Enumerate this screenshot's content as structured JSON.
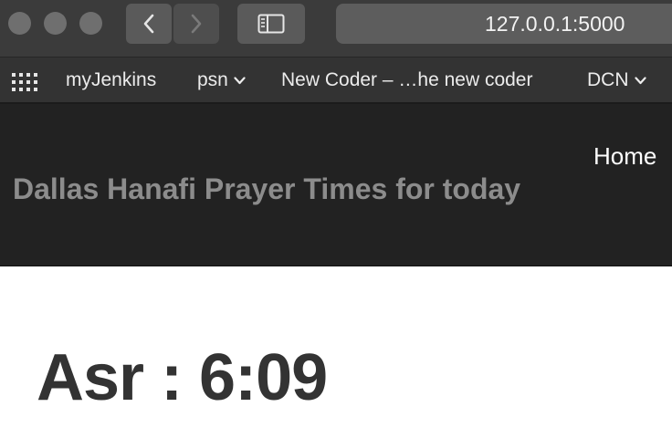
{
  "browser": {
    "url": "127.0.0.1:5000",
    "bookmarks": [
      {
        "label": "myJenkins",
        "has_menu": false
      },
      {
        "label": "psn",
        "has_menu": true
      },
      {
        "label": "New Coder – …he new coder",
        "has_menu": false
      },
      {
        "label": "DCN",
        "has_menu": true
      }
    ],
    "icons": {
      "back": "chevron-left-icon",
      "forward": "chevron-right-icon",
      "sidebar": "sidebar-icon",
      "bookmarks_grid": "grid-icon"
    }
  },
  "site": {
    "title": "Dallas Hanafi Prayer Times for today",
    "nav": {
      "home": "Home"
    }
  },
  "main": {
    "prayer_text": "Asr : 6:09"
  }
}
